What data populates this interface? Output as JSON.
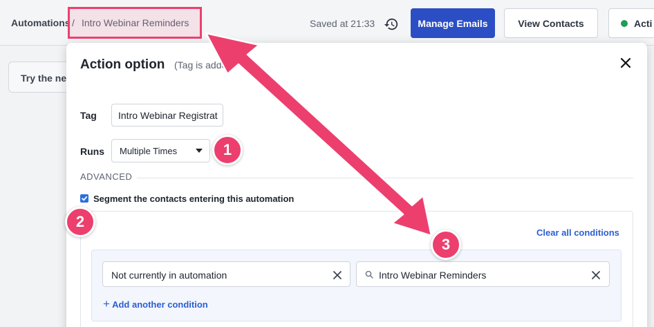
{
  "header": {
    "breadcrumb_root": "Automations",
    "breadcrumb_sep": "/",
    "breadcrumb_current": "Intro Webinar Reminders",
    "saved_text": "Saved at 21:33",
    "manage_emails_label": "Manage Emails",
    "view_contacts_label": "View Contacts",
    "status_label": "Acti"
  },
  "background": {
    "banner_text": "Try the ne"
  },
  "modal": {
    "title": "Action option",
    "subtitle": "(Tag is added",
    "tag_label": "Tag",
    "tag_value": "Intro Webinar Registrat",
    "runs_label": "Runs",
    "runs_value": "Multiple Times",
    "advanced_heading": "ADVANCED",
    "segment_label": "Segment the contacts entering this automation",
    "segment_checked": true,
    "clear_conditions_label": "Clear all conditions",
    "conditions": [
      {
        "field": "Not currently in automation",
        "value": "Intro Webinar Reminders"
      }
    ],
    "add_condition_label": "Add another condition",
    "add_condition_plus": "+"
  },
  "annotations": {
    "badge_1": "1",
    "badge_2": "2",
    "badge_3": "3"
  },
  "colors": {
    "accent": "#ec3f6e",
    "primary": "#2b4ec4",
    "link": "#2b5fd0",
    "status": "#1f9d55"
  }
}
